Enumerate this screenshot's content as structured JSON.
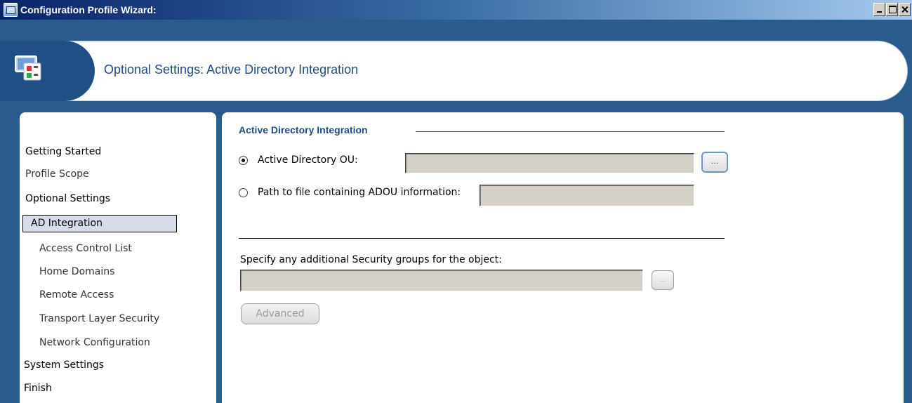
{
  "window": {
    "title": "Configuration Profile Wizard:",
    "icon": "wizard-app-icon",
    "controls": [
      "minimize",
      "maximize",
      "close"
    ]
  },
  "header": {
    "title": "Optional Settings: Active Directory Integration",
    "icon": "network-config-icon"
  },
  "nav": {
    "items": [
      {
        "label": "Getting Started",
        "level": 0,
        "selected": false
      },
      {
        "label": "Profile Scope",
        "level": 0,
        "selected": false
      },
      {
        "label": "Optional Settings",
        "level": 0,
        "selected": false
      },
      {
        "label": "AD Integration",
        "level": 1,
        "selected": true
      },
      {
        "label": "Access Control List",
        "level": 1,
        "selected": false
      },
      {
        "label": "Home Domains",
        "level": 1,
        "selected": false
      },
      {
        "label": "Remote Access",
        "level": 1,
        "selected": false
      },
      {
        "label": "Transport Layer Security",
        "level": 1,
        "selected": false
      },
      {
        "label": "Network Configuration",
        "level": 1,
        "selected": false
      },
      {
        "label": "System Settings",
        "level": 0,
        "selected": false
      },
      {
        "label": "Finish",
        "level": 0,
        "selected": false
      }
    ]
  },
  "content": {
    "group_title": "Active Directory Integration",
    "option_ou": {
      "label": "Active Directory OU:",
      "checked": true,
      "value": ""
    },
    "option_file": {
      "label": "Path to file containing ADOU information:",
      "checked": false,
      "value": ""
    },
    "security_groups": {
      "label": "Specify any additional Security groups for the object:",
      "value": ""
    },
    "browse_label": "...",
    "advanced_label": "Advanced"
  },
  "colors": {
    "frame": "#2a5b8d",
    "accent_text": "#1f4a87",
    "field_bg": "#d4d0c8"
  }
}
